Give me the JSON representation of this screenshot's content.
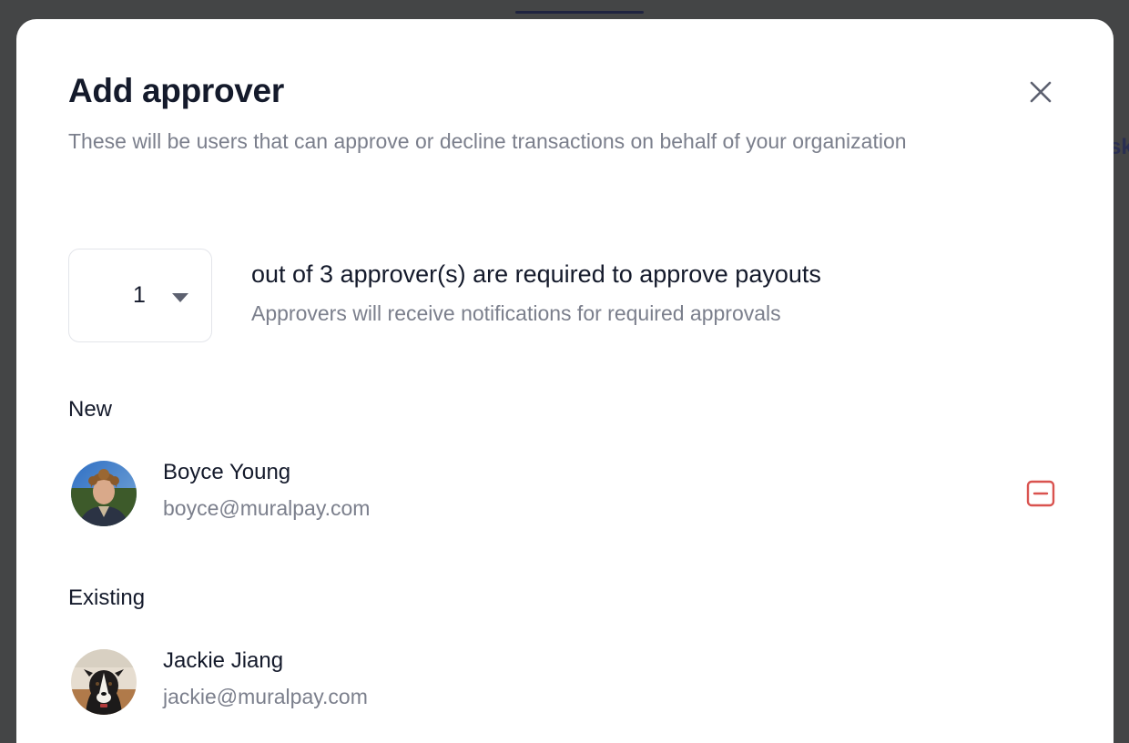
{
  "background": {
    "peek_text": "sk"
  },
  "modal": {
    "title": "Add approver",
    "subtitle": "These will be users that can approve or decline transactions on behalf of your organization",
    "close_icon": "close-icon"
  },
  "threshold": {
    "selected": "1",
    "caret_icon": "caret-down-icon",
    "text": "out of 3 approver(s) are required to approve payouts",
    "hint": "Approvers will receive notifications for required approvals"
  },
  "sections": {
    "new_label": "New",
    "existing_label": "Existing"
  },
  "new_approvers": [
    {
      "name": "Boyce Young",
      "email": "boyce@muralpay.com",
      "remove_icon": "minus-square-icon"
    }
  ],
  "existing_approvers": [
    {
      "name": "Jackie Jiang",
      "email": "jackie@muralpay.com"
    }
  ],
  "colors": {
    "backdrop": "#444546",
    "title": "#141a2b",
    "muted_text": "#7b7f8c",
    "remove_accent": "#d9534f",
    "close_icon": "#5d6170"
  }
}
